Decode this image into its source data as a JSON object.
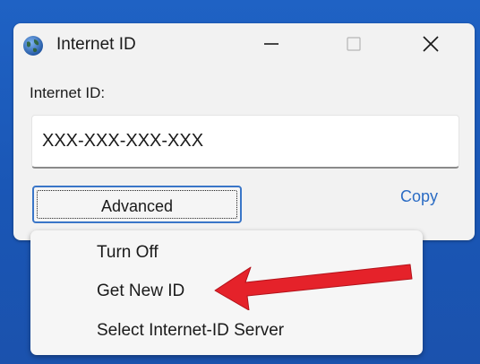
{
  "window": {
    "title": "Internet ID",
    "icon": "globe-icon",
    "controls": [
      "minimize-icon",
      "maximize-icon",
      "close-icon"
    ]
  },
  "main": {
    "field_label": "Internet ID:",
    "id_value": "XXX-XXX-XXX-XXX",
    "advanced_label": "Advanced",
    "copy_label": "Copy"
  },
  "menu": {
    "items": [
      "Turn Off",
      "Get New ID",
      "Select Internet-ID Server"
    ]
  },
  "annotation": {
    "arrow_color": "#e5222a",
    "points_to": "Get New ID"
  },
  "colors": {
    "desktop": "#1b57b8",
    "window": "#f2f2f2",
    "accent": "#2b6cc4"
  }
}
